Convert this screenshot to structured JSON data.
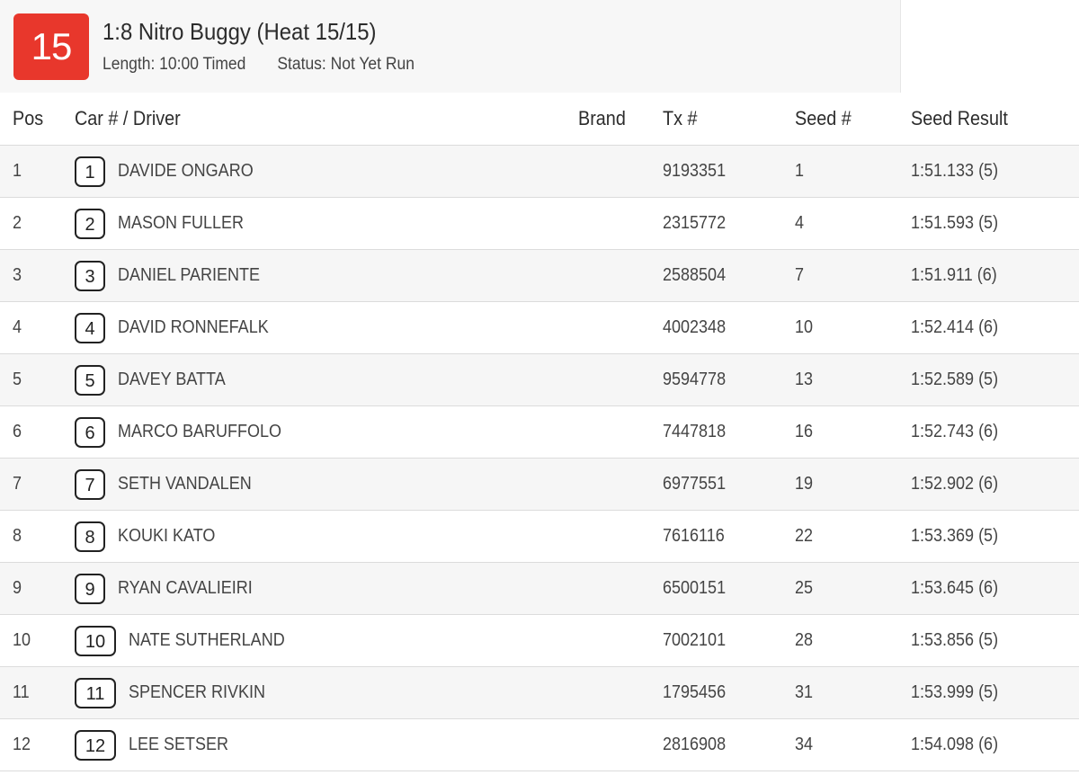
{
  "heat": {
    "number": "15",
    "title": "1:8 Nitro Buggy (Heat 15/15)",
    "length": "Length: 10:00 Timed",
    "status": "Status: Not Yet Run",
    "badge_color": "#e8372c"
  },
  "columns": {
    "pos": "Pos",
    "car_driver": "Car # / Driver",
    "brand": "Brand",
    "tx": "Tx #",
    "seed": "Seed #",
    "seed_result": "Seed Result"
  },
  "rows": [
    {
      "pos": "1",
      "car": "1",
      "driver": "DAVIDE ONGARO",
      "brand": "",
      "tx": "9193351",
      "seed": "1",
      "seed_result": "1:51.133 (5)"
    },
    {
      "pos": "2",
      "car": "2",
      "driver": "MASON FULLER",
      "brand": "",
      "tx": "2315772",
      "seed": "4",
      "seed_result": "1:51.593 (5)"
    },
    {
      "pos": "3",
      "car": "3",
      "driver": "DANIEL PARIENTE",
      "brand": "",
      "tx": "2588504",
      "seed": "7",
      "seed_result": "1:51.911 (6)"
    },
    {
      "pos": "4",
      "car": "4",
      "driver": "DAVID RONNEFALK",
      "brand": "",
      "tx": "4002348",
      "seed": "10",
      "seed_result": "1:52.414 (6)"
    },
    {
      "pos": "5",
      "car": "5",
      "driver": "DAVEY BATTA",
      "brand": "",
      "tx": "9594778",
      "seed": "13",
      "seed_result": "1:52.589 (5)"
    },
    {
      "pos": "6",
      "car": "6",
      "driver": "MARCO BARUFFOLO",
      "brand": "",
      "tx": "7447818",
      "seed": "16",
      "seed_result": "1:52.743 (6)"
    },
    {
      "pos": "7",
      "car": "7",
      "driver": "SETH VANDALEN",
      "brand": "",
      "tx": "6977551",
      "seed": "19",
      "seed_result": "1:52.902 (6)"
    },
    {
      "pos": "8",
      "car": "8",
      "driver": "KOUKI KATO",
      "brand": "",
      "tx": "7616116",
      "seed": "22",
      "seed_result": "1:53.369 (5)"
    },
    {
      "pos": "9",
      "car": "9",
      "driver": "RYAN CAVALIEIRI",
      "brand": "",
      "tx": "6500151",
      "seed": "25",
      "seed_result": "1:53.645 (6)"
    },
    {
      "pos": "10",
      "car": "10",
      "driver": "NATE SUTHERLAND",
      "brand": "",
      "tx": "7002101",
      "seed": "28",
      "seed_result": "1:53.856 (5)"
    },
    {
      "pos": "11",
      "car": "11",
      "driver": "SPENCER RIVKIN",
      "brand": "",
      "tx": "1795456",
      "seed": "31",
      "seed_result": "1:53.999 (5)"
    },
    {
      "pos": "12",
      "car": "12",
      "driver": "LEE SETSER",
      "brand": "",
      "tx": "2816908",
      "seed": "34",
      "seed_result": "1:54.098 (6)"
    }
  ]
}
